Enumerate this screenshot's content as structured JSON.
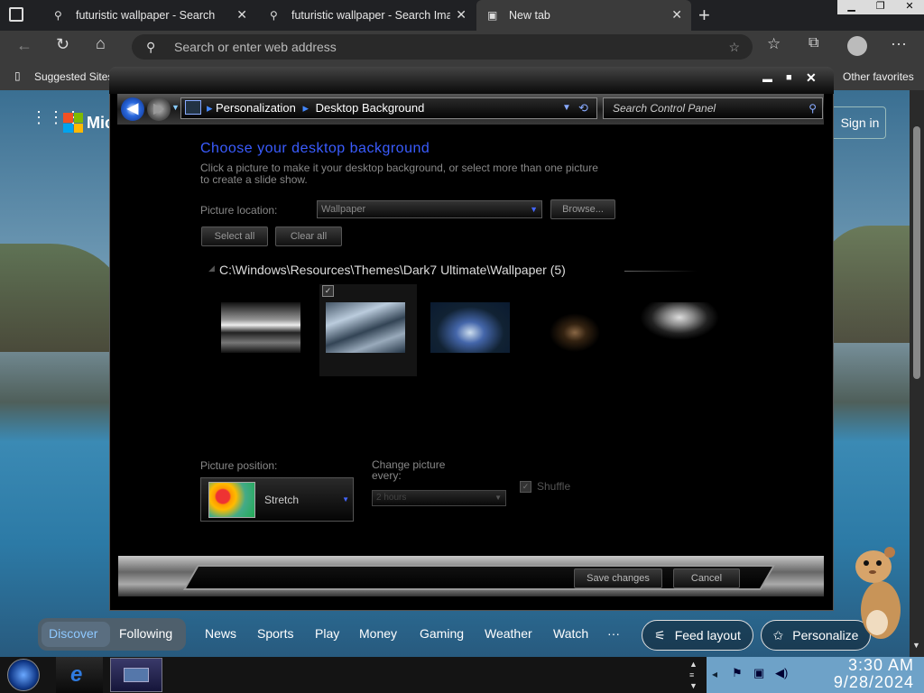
{
  "browser": {
    "tabs": [
      {
        "label": "futuristic wallpaper - Search"
      },
      {
        "label": "futuristic wallpaper - Search Ima"
      },
      {
        "label": "New tab"
      }
    ],
    "address_placeholder": "Search or enter web address",
    "favorites": {
      "suggested": "Suggested Sites",
      "other": "Other favorites"
    }
  },
  "msn": {
    "logo_text": "Mic",
    "sign_in": "Sign in",
    "tabs": [
      "Discover",
      "Following"
    ],
    "nav": [
      "News",
      "Sports",
      "Play",
      "Money",
      "Gaming",
      "Weather",
      "Watch",
      "···"
    ],
    "feed_layout": "Feed layout",
    "personalize": "Personalize"
  },
  "control_panel": {
    "breadcrumb": [
      "Personalization",
      "Desktop Background"
    ],
    "search_placeholder": "Search Control Panel",
    "heading": "Choose your desktop background",
    "instructions_line1": "Click a picture to make it your desktop background, or select more than one picture",
    "instructions_line2": "to create a slide show.",
    "picture_location_label": "Picture location:",
    "picture_location_value": "Wallpaper",
    "browse_button": "Browse...",
    "select_all_button": "Select all",
    "clear_all_button": "Clear all",
    "folder_path": "C:\\Windows\\Resources\\Themes\\Dark7 Ultimate\\Wallpaper (5)",
    "picture_position_label": "Picture position:",
    "picture_position_value": "Stretch",
    "change_picture_label_line1": "Change picture",
    "change_picture_label_line2": "every:",
    "change_interval_value": "2 hours",
    "shuffle_label": "Shuffle",
    "save_button": "Save changes",
    "cancel_button": "Cancel"
  },
  "taskbar": {
    "time": "3:30 AM",
    "date": "9/28/2024"
  },
  "colors": {
    "accent_blue": "#3355ff",
    "heading_blue": "#3a5cff",
    "tab_active": "#3b3b3b"
  }
}
